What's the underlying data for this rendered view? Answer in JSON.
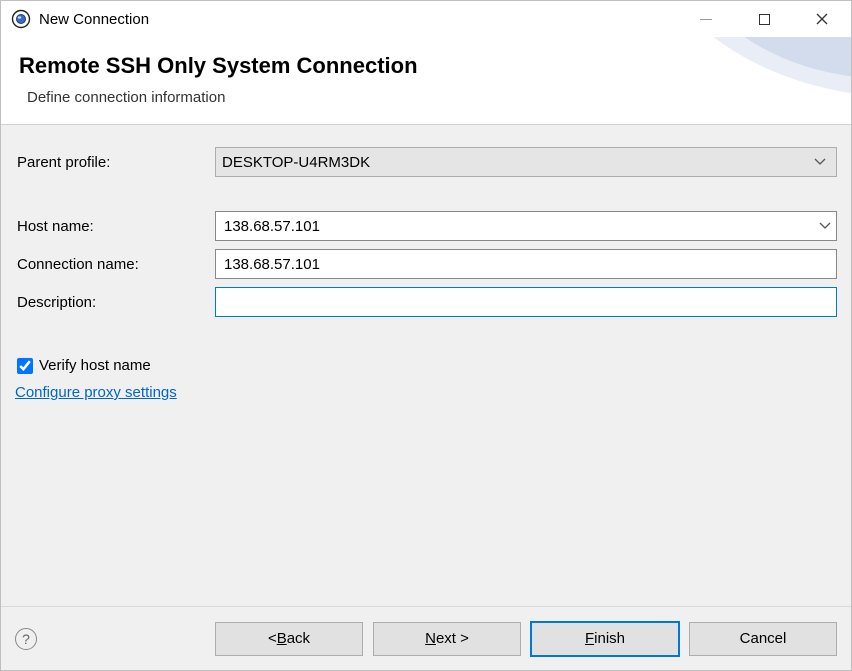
{
  "window": {
    "title": "New Connection"
  },
  "header": {
    "heading": "Remote SSH Only System Connection",
    "subtitle": "Define connection information"
  },
  "form": {
    "parent_label": "Parent profile:",
    "parent_value": "DESKTOP-U4RM3DK",
    "host_label": "Host name:",
    "host_value": "138.68.57.101",
    "conn_label": "Connection name:",
    "conn_value": "138.68.57.101",
    "desc_label": "Description:",
    "desc_value": "",
    "verify_label": "Verify host name",
    "verify_checked": true,
    "proxy_link": "Configure proxy settings"
  },
  "buttons": {
    "back_prefix": "< ",
    "back_mnemonic": "B",
    "back_rest": "ack",
    "next_mnemonic": "N",
    "next_rest": "ext >",
    "finish_mnemonic": "F",
    "finish_rest": "inish",
    "cancel": "Cancel"
  }
}
